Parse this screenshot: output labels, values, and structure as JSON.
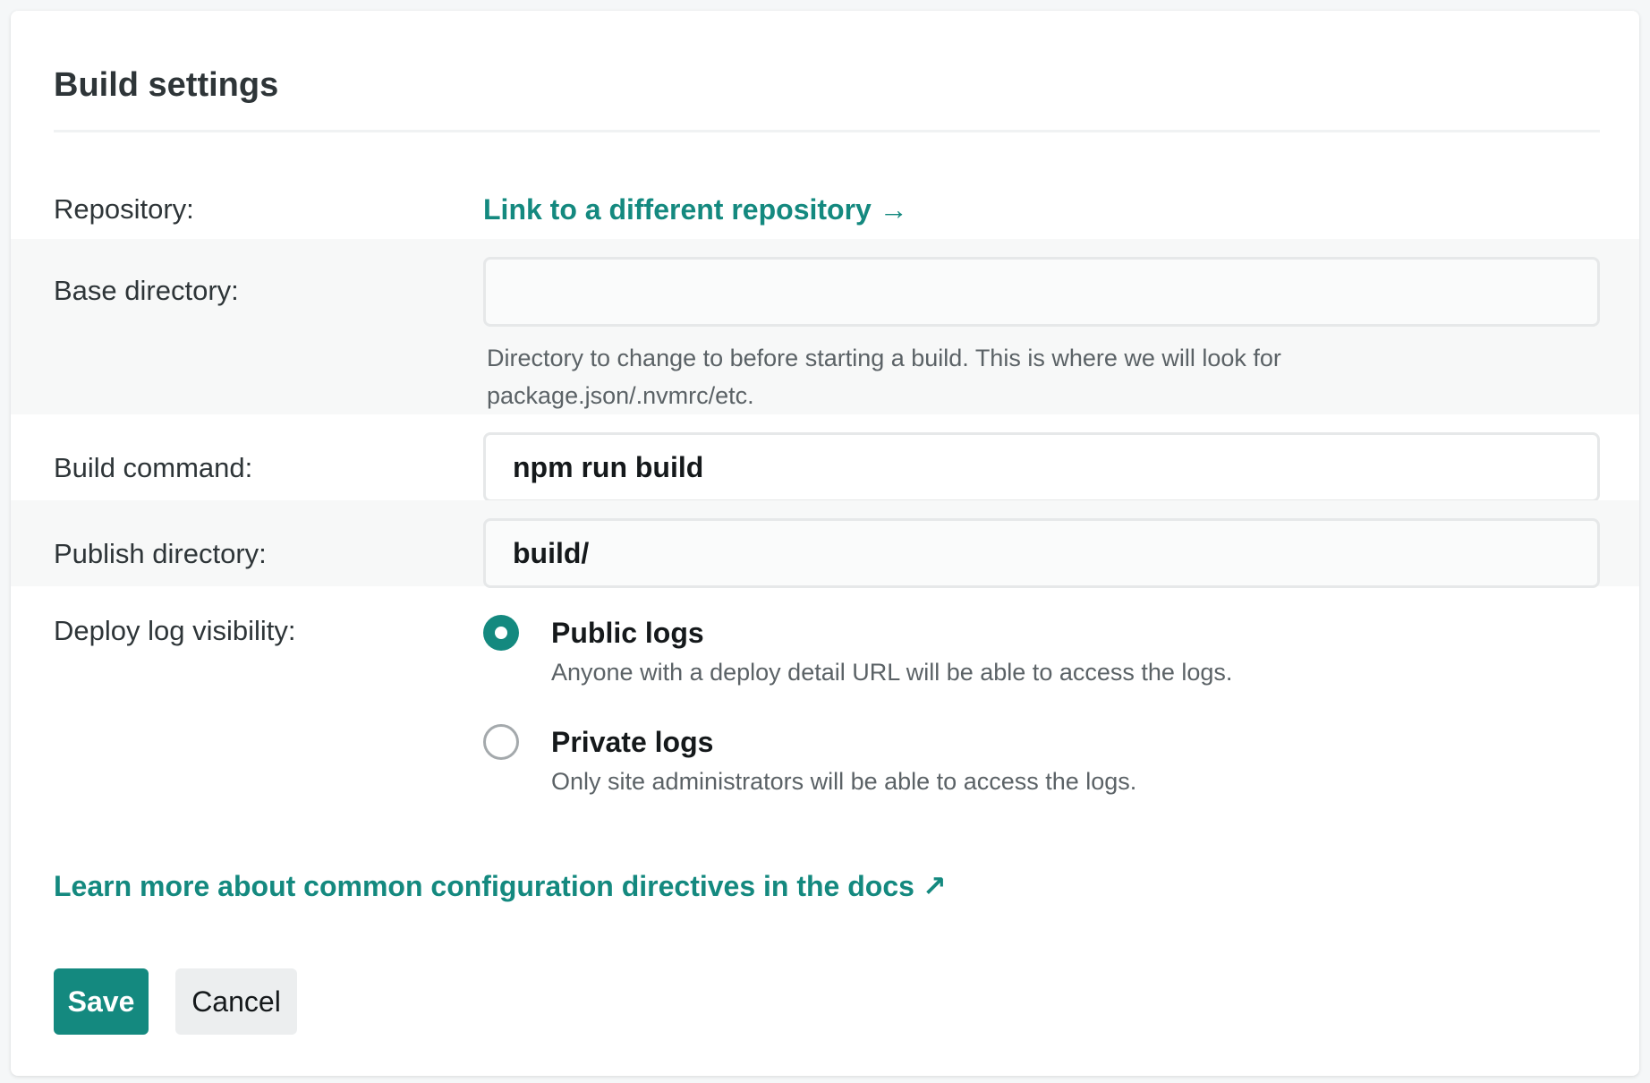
{
  "card": {
    "title": "Build settings"
  },
  "repository": {
    "label": "Repository:",
    "link_text": "Link to a different repository",
    "link_arrow": "→"
  },
  "base_directory": {
    "label": "Base directory:",
    "value": "",
    "help": "Directory to change to before starting a build. This is where we will look for package.json/.nvmrc/etc."
  },
  "build_command": {
    "label": "Build command:",
    "value": "npm run build"
  },
  "publish_directory": {
    "label": "Publish directory:",
    "value": "build/"
  },
  "deploy_log_visibility": {
    "label": "Deploy log visibility:",
    "options": [
      {
        "title": "Public logs",
        "description": "Anyone with a deploy detail URL will be able to access the logs.",
        "checked": true
      },
      {
        "title": "Private logs",
        "description": "Only site administrators will be able to access the logs.",
        "checked": false
      }
    ]
  },
  "docs_link": {
    "text": "Learn more about common configuration directives in the docs",
    "arrow": "↗"
  },
  "actions": {
    "save_label": "Save",
    "cancel_label": "Cancel"
  },
  "colors": {
    "accent": "#14897f",
    "text": "#2e3538",
    "muted": "#5b6266",
    "shaded_row": "#f7f8f8"
  }
}
